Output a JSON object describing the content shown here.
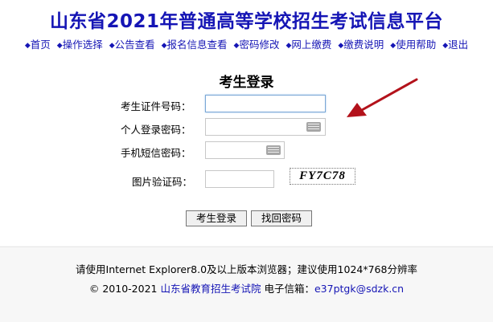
{
  "header": {
    "title": "山东省2021年普通高等学校招生考试信息平台",
    "nav": [
      "首页",
      "操作选择",
      "公告查看",
      "报名信息查看",
      "密码修改",
      "网上缴费",
      "缴费说明",
      "使用帮助",
      "退出"
    ]
  },
  "login": {
    "title": "考生登录",
    "id_label": "考生证件号码：",
    "password_label": "个人登录密码：",
    "sms_label": "手机短信密码：",
    "captcha_label": "图片验证码：",
    "captcha_text": "FY7C78",
    "login_button": "考生登录",
    "recover_button": "找回密码"
  },
  "footer": {
    "line1": "请使用Internet Explorer8.0及以上版本浏览器；建议使用1024*768分辨率",
    "copyright": "© 2010-2021",
    "org_link": "山东省教育招生考试院",
    "email_label": "电子信箱：",
    "email_link": "e37ptgk@sdzk.cn"
  },
  "colors": {
    "title": "#1515b5",
    "arrow": "#b3121b"
  }
}
